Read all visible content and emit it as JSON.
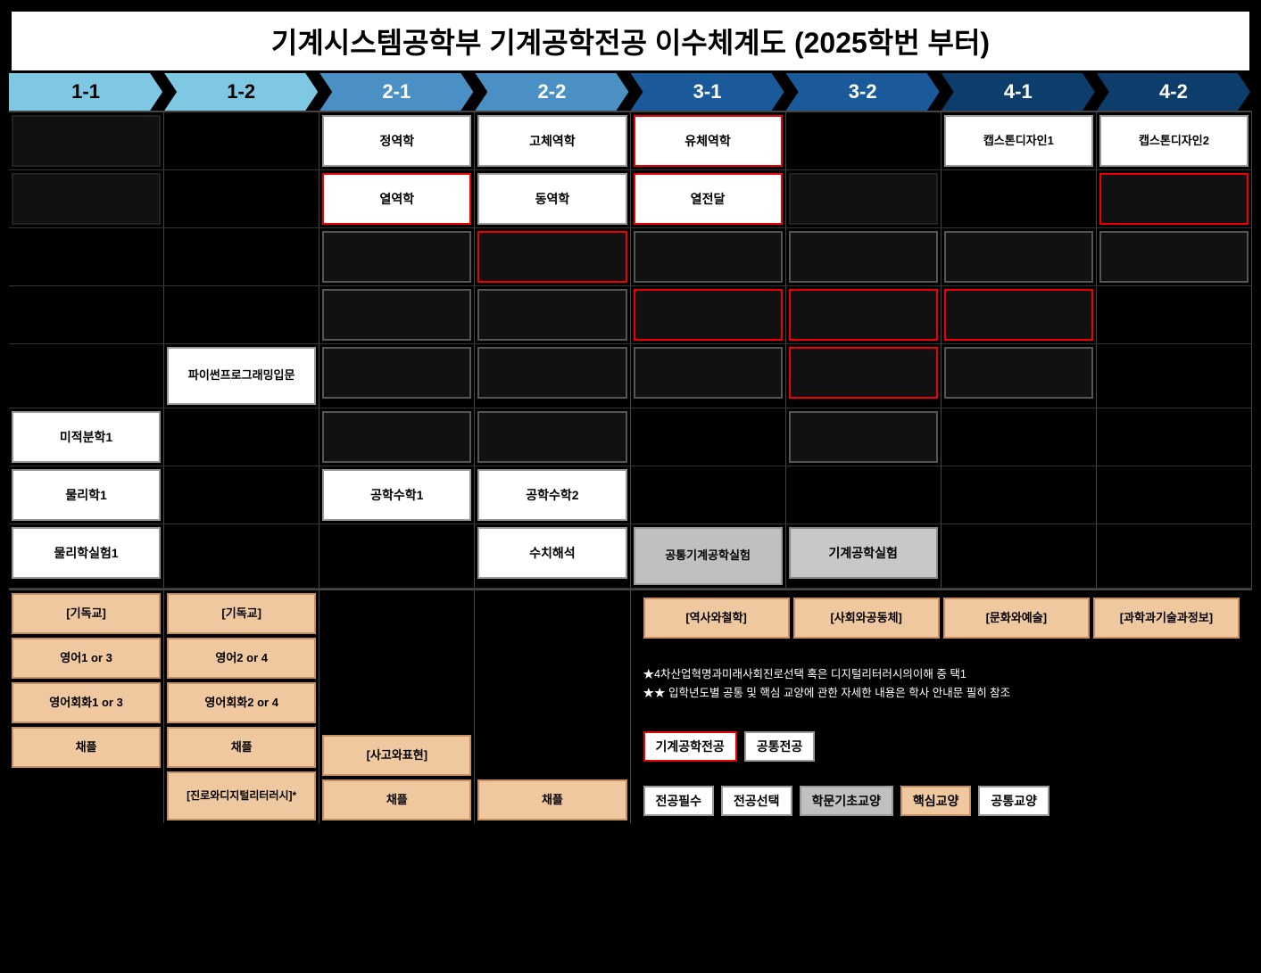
{
  "title": "기계시스템공학부 기계공학전공 이수체계도 (2025학번 부터)",
  "headers": [
    {
      "label": "1-1",
      "color": "light-blue"
    },
    {
      "label": "1-2",
      "color": "light-blue"
    },
    {
      "label": "2-1",
      "color": "medium-blue"
    },
    {
      "label": "2-2",
      "color": "medium-blue"
    },
    {
      "label": "3-1",
      "color": "dark-blue"
    },
    {
      "label": "3-2",
      "color": "dark-blue"
    },
    {
      "label": "4-1",
      "color": "darker-blue"
    },
    {
      "label": "4-2",
      "color": "darker-blue"
    }
  ],
  "grid": {
    "row1": [
      {
        "type": "black-filled",
        "text": ""
      },
      {
        "type": "empty",
        "text": ""
      },
      {
        "type": "white",
        "text": "정역학"
      },
      {
        "type": "white",
        "text": "고체역학"
      },
      {
        "type": "red-border",
        "text": "유체역학"
      },
      {
        "type": "empty",
        "text": ""
      },
      {
        "type": "white",
        "text": "캡스톤디자인1"
      },
      {
        "type": "white",
        "text": "캡스톤디자인2"
      }
    ],
    "row2": [
      {
        "type": "black-filled",
        "text": ""
      },
      {
        "type": "empty",
        "text": ""
      },
      {
        "type": "red-border",
        "text": "열역학"
      },
      {
        "type": "white",
        "text": "동역학"
      },
      {
        "type": "red-border",
        "text": "열전달"
      },
      {
        "type": "black-filled",
        "text": ""
      },
      {
        "type": "empty",
        "text": ""
      },
      {
        "type": "red-border",
        "text": ""
      }
    ],
    "row3": [
      {
        "type": "empty",
        "text": ""
      },
      {
        "type": "empty",
        "text": ""
      },
      {
        "type": "white",
        "text": ""
      },
      {
        "type": "red-border",
        "text": ""
      },
      {
        "type": "white",
        "text": ""
      },
      {
        "type": "white",
        "text": ""
      },
      {
        "type": "white",
        "text": ""
      },
      {
        "type": "white",
        "text": ""
      }
    ],
    "row4": [
      {
        "type": "empty",
        "text": ""
      },
      {
        "type": "empty",
        "text": ""
      },
      {
        "type": "white",
        "text": ""
      },
      {
        "type": "white",
        "text": ""
      },
      {
        "type": "red-border",
        "text": ""
      },
      {
        "type": "red-border",
        "text": ""
      },
      {
        "type": "red-border",
        "text": ""
      },
      {
        "type": "empty",
        "text": ""
      }
    ],
    "row5": [
      {
        "type": "empty",
        "text": ""
      },
      {
        "type": "white",
        "text": "파이썬프로그래밍입문"
      },
      {
        "type": "white",
        "text": ""
      },
      {
        "type": "white",
        "text": ""
      },
      {
        "type": "white",
        "text": ""
      },
      {
        "type": "red-border",
        "text": ""
      },
      {
        "type": "white",
        "text": ""
      },
      {
        "type": "empty",
        "text": ""
      }
    ],
    "row6": [
      {
        "type": "white",
        "text": "미적분학1"
      },
      {
        "type": "empty",
        "text": ""
      },
      {
        "type": "white",
        "text": ""
      },
      {
        "type": "white",
        "text": ""
      },
      {
        "type": "empty",
        "text": ""
      },
      {
        "type": "white",
        "text": ""
      },
      {
        "type": "empty",
        "text": ""
      },
      {
        "type": "empty",
        "text": ""
      }
    ],
    "row7": [
      {
        "type": "white",
        "text": "물리학1"
      },
      {
        "type": "empty",
        "text": ""
      },
      {
        "type": "white",
        "text": "공학수학1"
      },
      {
        "type": "white",
        "text": "공학수학2"
      },
      {
        "type": "empty",
        "text": ""
      },
      {
        "type": "empty",
        "text": ""
      },
      {
        "type": "empty",
        "text": ""
      },
      {
        "type": "empty",
        "text": ""
      }
    ],
    "row8": [
      {
        "type": "white",
        "text": "물리학실험1"
      },
      {
        "type": "empty",
        "text": ""
      },
      {
        "type": "empty",
        "text": ""
      },
      {
        "type": "white",
        "text": "수치해석"
      },
      {
        "type": "gray",
        "text": "공통기계공학실험"
      },
      {
        "type": "gray",
        "text": "기계공학실험"
      },
      {
        "type": "empty",
        "text": ""
      },
      {
        "type": "empty",
        "text": ""
      }
    ]
  },
  "bottom": {
    "col1_1": [
      {
        "type": "peach",
        "text": "[기독교]"
      },
      {
        "type": "peach",
        "text": "영어1 or 3"
      },
      {
        "type": "peach",
        "text": "영어회화1 or 3"
      },
      {
        "type": "peach",
        "text": "채플"
      }
    ],
    "col1_2": [
      {
        "type": "peach",
        "text": "[기독교]"
      },
      {
        "type": "peach",
        "text": "영어2 or 4"
      },
      {
        "type": "peach",
        "text": "영어회화2 or 4"
      },
      {
        "type": "peach",
        "text": "채플"
      },
      {
        "type": "peach",
        "text": "[진로와디지털리터러시]*"
      }
    ],
    "col2_1": [
      {
        "type": "peach",
        "text": "[사고와표현]"
      },
      {
        "type": "peach",
        "text": "채플"
      }
    ],
    "col2_2": [
      {
        "type": "peach",
        "text": "채플"
      }
    ],
    "col3_1": [
      {
        "type": "peach",
        "text": "[역사와철학]"
      }
    ],
    "col3_2": [
      {
        "type": "peach",
        "text": "[사회와공동체]"
      }
    ],
    "col4_1": [
      {
        "type": "peach",
        "text": "[문화와예술]"
      }
    ],
    "col4_2": [
      {
        "type": "peach",
        "text": "[과학과기술과정보]"
      }
    ],
    "notes": [
      "★4차산업혁명과미래사회진로선택 혹은 디지털리터러시의이해 중 택1",
      "★★ 입학년도별 공통 및 핵심 교양에 관한 자세한 내용은 학사 안내문 필히 참조"
    ],
    "legend": [
      {
        "type": "red-border",
        "text": "기계공학전공"
      },
      {
        "type": "white",
        "text": "공통전공"
      },
      {
        "type": "white",
        "text": "전공필수"
      },
      {
        "type": "white",
        "text": "전공선택"
      },
      {
        "type": "gray",
        "text": "학문기초교양"
      },
      {
        "type": "peach",
        "text": "핵심교양"
      },
      {
        "type": "white",
        "text": "공통교양"
      }
    ]
  }
}
